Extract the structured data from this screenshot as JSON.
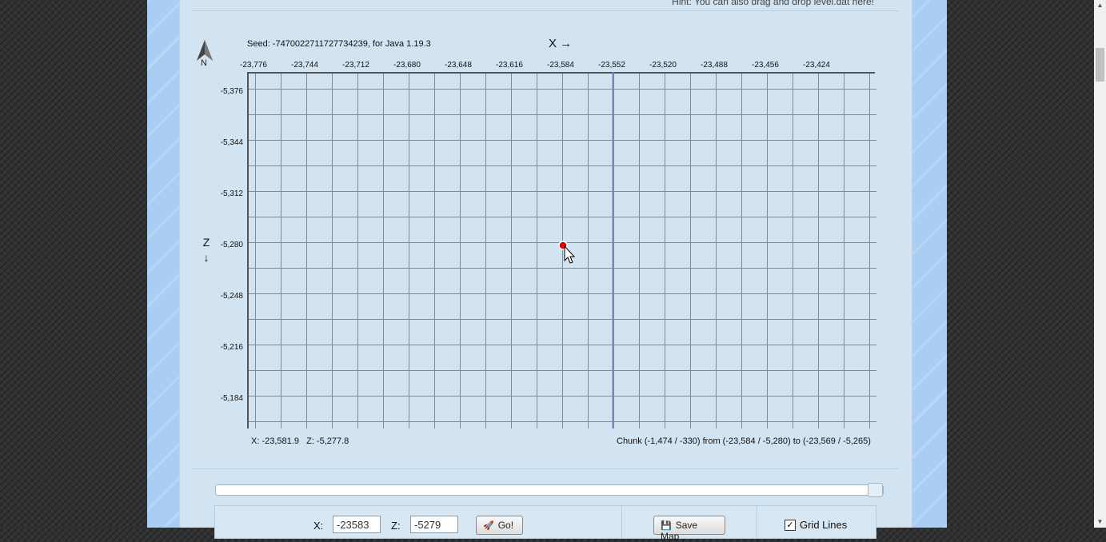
{
  "hint": "Hint: You can also drag and drop level.dat here!",
  "seed_label": "Seed: -7470022711727734239, for Java 1.19.3",
  "x_axis_label": "X →",
  "z_axis_label": "Z ↓",
  "compass_letter": "N",
  "x_ticks": [
    "-23,776",
    "-23,744",
    "-23,712",
    "-23,680",
    "-23,648",
    "-23,616",
    "-23,584",
    "-23,552",
    "-23,520",
    "-23,488",
    "-23,456",
    "-23,424"
  ],
  "z_ticks": [
    "-5,376",
    "-5,344",
    "-5,312",
    "-5,280",
    "-5,248",
    "-5,216",
    "-5,184"
  ],
  "status": {
    "coords": "X: -23,581.9   Z: -5,277.8",
    "chunk": "Chunk (-1,474 / -330) from (-23,584 / -5,280) to (-23,569 / -5,265)"
  },
  "controls": {
    "x_label": "X:",
    "x_value": "-23583",
    "z_label": "Z:",
    "z_value": "-5279",
    "go_label": "Go!",
    "save_map_label": "Save Map",
    "grid_lines_label": "Grid Lines",
    "grid_lines_checked": true
  },
  "colors": {
    "panel": "#d2e4f2",
    "grid_line": "#888888",
    "chunk_boundary": "#7f7fb5",
    "marker": "#e00000"
  },
  "icons": {
    "compass": "north-arrow-icon",
    "go": "rocket-icon",
    "save": "floppy-icon",
    "checkbox": "check-icon"
  }
}
